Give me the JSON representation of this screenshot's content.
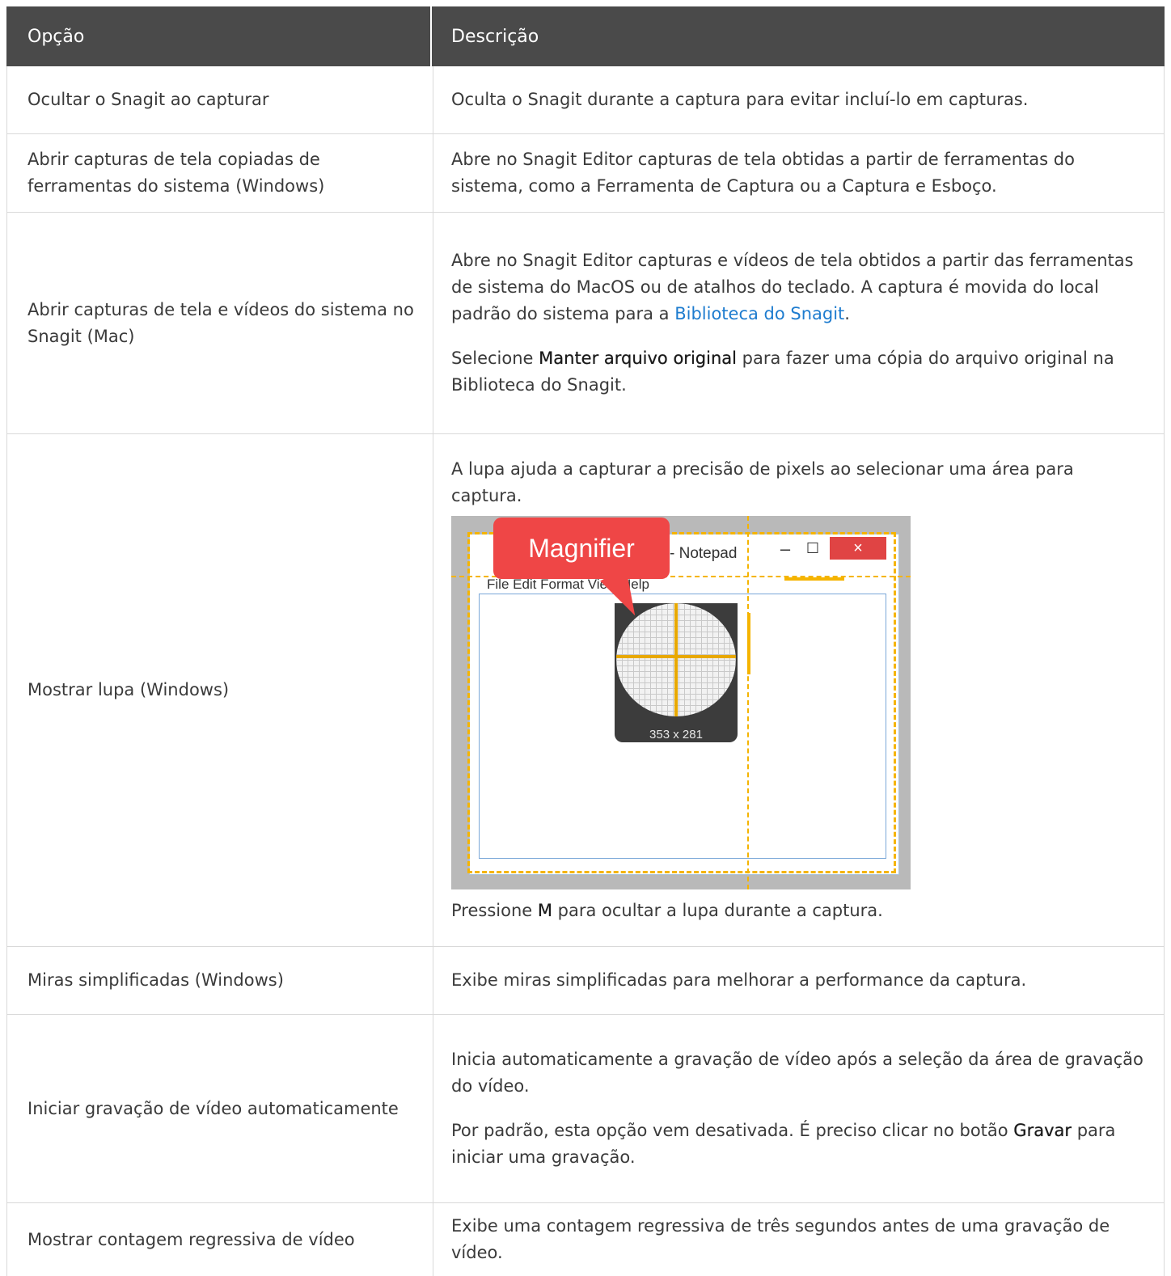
{
  "header": {
    "col_option": "Opção",
    "col_description": "Descrição"
  },
  "rows": [
    {
      "option": "Ocultar o Snagit ao capturar",
      "description": "Oculta o Snagit durante a captura para evitar incluí-lo em capturas."
    },
    {
      "option": "Abrir capturas de tela copiadas de ferramentas do sistema (Windows)",
      "description": "Abre no Snagit Editor capturas de tela obtidas a partir de ferramentas do sistema, como a Ferramenta de Captura ou a Captura e Esboço."
    },
    {
      "option": "Abrir capturas de tela e vídeos do sistema no Snagit (Mac)",
      "description_before_link": "Abre no Snagit Editor capturas e vídeos de tela obtidos a partir das ferramentas de sistema do MacOS ou de atalhos do teclado. A captura é movida do local padrão do sistema para a ",
      "link": "Biblioteca do Snagit",
      "description_after_link": ".",
      "note_prefix": "Selecione ",
      "note_bold": "Manter arquivo original",
      "note_suffix": " para fazer uma cópia do arquivo original na Biblioteca do Snagit."
    },
    {
      "option": "Mostrar lupa (Windows)",
      "description": "A lupa ajuda a capturar a precisão de pixels ao selecionar uma área para captura.",
      "image": {
        "bubble": "Magnifier",
        "window_title": "- Notepad",
        "menu": "File   Edit   Format   View   Help",
        "dimensions": "353 x 281",
        "minimize": "–",
        "maximize": "☐",
        "close": "×"
      },
      "note_prefix": "Pressione ",
      "note_bold": "M",
      "note_suffix": " para ocultar a lupa durante a captura."
    },
    {
      "option": "Miras simplificadas (Windows)",
      "description": "Exibe miras simplificadas para melhorar a performance da captura."
    },
    {
      "option": "Iniciar gravação de vídeo automaticamente",
      "description": "Inicia automaticamente a gravação de vídeo após a seleção da área de gravação do vídeo.",
      "note_prefix": "Por padrão, esta opção vem desativada. É preciso clicar no botão ",
      "note_bold": "Gravar",
      "note_suffix": " para iniciar uma gravação."
    },
    {
      "option": "Mostrar contagem regressiva de vídeo",
      "description": "Exibe uma contagem regressiva de três segundos antes de uma gravação de vídeo."
    }
  ]
}
